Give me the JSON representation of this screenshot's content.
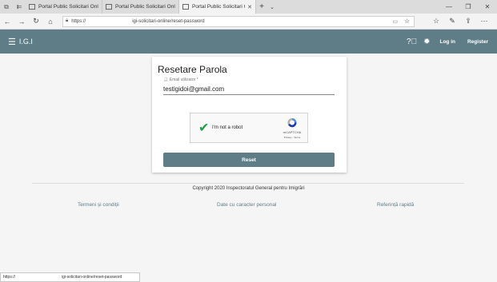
{
  "browser": {
    "tabs": [
      {
        "title": "Portal Public Solicitari Onlin",
        "active": false
      },
      {
        "title": "Portal Public Solicitari Onlin",
        "active": false
      },
      {
        "title": "Portal Public Solicitari C",
        "active": true
      }
    ],
    "url_prefix": "https://",
    "url_path": "igi-solicitari-online/reset-password",
    "status_prefix": "https://",
    "status_path": "igi-solicitari-online/reset-password"
  },
  "appbar": {
    "brand": "I.G.I",
    "login": "Log in",
    "register": "Register"
  },
  "form": {
    "title": "Resetare Parola",
    "email_label": "Email utilizator *",
    "email_value": "testigidoi@gmail.com",
    "captcha_label": "I'm not a robot",
    "captcha_brand": "reCAPTCHA",
    "captcha_links": "Privacy - Terms",
    "reset_label": "Reset"
  },
  "footer": {
    "copyright": "Copyright 2020 Inspectoratul General pentru Imigrări",
    "links": [
      "Termeni și condiții",
      "Date cu caracter personal",
      "Referință rapidă"
    ]
  },
  "colors": {
    "primary": "#5e7d87",
    "check": "#1e9e47"
  }
}
